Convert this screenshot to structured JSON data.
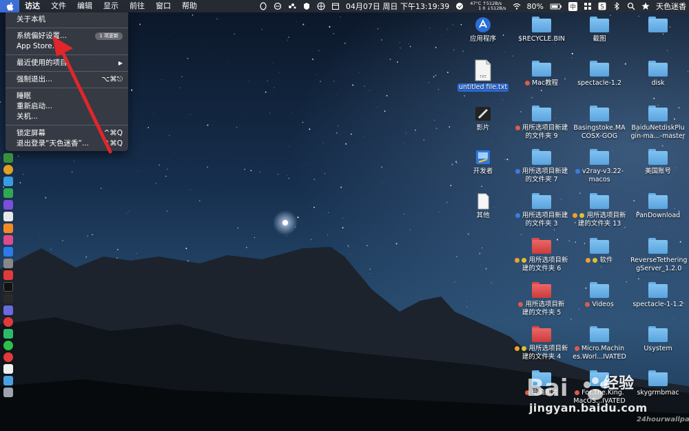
{
  "menubar": {
    "app_name": "访达",
    "menus": [
      "文件",
      "编辑",
      "显示",
      "前往",
      "窗口",
      "帮助"
    ],
    "clock": "04月07日 周日 下午13:19:39",
    "cpu_temp": "47°C",
    "cpu_value": "1",
    "net_up": "↑512B/s",
    "net_down_prefix": "0",
    "net_down": "↓512B/s",
    "battery_percent": "80%",
    "input_method": "中",
    "user_name": "天色迷香"
  },
  "apple_menu": {
    "items": [
      {
        "label": "关于本机"
      },
      {
        "label": "系统偏好设置...",
        "badge": "1 项更新"
      },
      {
        "label": "App Store..."
      },
      {
        "label": "最近使用的项目",
        "submenu": "▶"
      },
      {
        "label": "强制退出...",
        "shortcut": "⌥⌘⎋"
      },
      {
        "label": "睡眠"
      },
      {
        "label": "重新启动..."
      },
      {
        "label": "关机..."
      },
      {
        "label": "锁定屏幕",
        "shortcut": "^⌘Q"
      },
      {
        "label": "退出登录“天色迷香”...",
        "shortcut": "⇧⌘Q"
      }
    ]
  },
  "desktop": {
    "col1": [
      {
        "label": "应用程序",
        "icon": "apps-icon"
      },
      {
        "label": "untitled file.txt",
        "icon": "text-file-icon",
        "selected": true
      },
      {
        "label": "影片",
        "icon": "movies-icon"
      },
      {
        "label": "开发者",
        "icon": "developer-icon"
      },
      {
        "label": "其他",
        "icon": "document-icon"
      }
    ],
    "col2": [
      {
        "label": "$RECYCLE.BIN",
        "color": "blue",
        "tags": []
      },
      {
        "label": "Mac教程",
        "color": "blue",
        "tags": [
          "#e05a4a"
        ]
      },
      {
        "label": "用所选项目新建的文件夹 9",
        "line1": "用所选项目新建",
        "line2": "的文件夹 9",
        "color": "blue",
        "tags": [
          "#e05a4a"
        ]
      },
      {
        "label": "用所选项目新建的文件夹 7",
        "line1": "用所选项目新建",
        "line2": "的文件夹 7",
        "color": "blue",
        "tags": [
          "#3d7be0"
        ]
      },
      {
        "label": "用所选项目新建的文件夹 3",
        "line1": "用所选项目新建",
        "line2": "的文件夹 3",
        "color": "blue",
        "tags": [
          "#3d7be0"
        ]
      },
      {
        "label": "用所选项目新建的文件夹 6",
        "line1": "用所选项目新",
        "line2": "建的文件夹 6",
        "color": "red",
        "tags": [
          "#f0a030",
          "#e0c030"
        ]
      },
      {
        "label": "用所选项目新建的文件夹 5",
        "line1": "用所选项目新",
        "line2": "建的文件夹 5",
        "color": "red",
        "tags": [
          "#e05a4a"
        ]
      },
      {
        "label": "用所选项目新建的文件夹 4",
        "line1": "用所选项目新",
        "line2": "建的文件夹 4",
        "color": "red",
        "tags": [
          "#f0a030",
          "#e0c030"
        ]
      },
      {
        "label": "电脑图片",
        "color": "blue",
        "tags": [
          "#e05a4a"
        ]
      }
    ],
    "col3": [
      {
        "label": "截图",
        "color": "blue",
        "tags": []
      },
      {
        "label": "spectacle-1.2",
        "color": "blue",
        "tags": []
      },
      {
        "label": "Basingstoke.MACOSX-GOG",
        "line1": "Basingstoke.MA",
        "line2": "COSX-GOG",
        "color": "blue",
        "tags": []
      },
      {
        "label": "v2ray-v3.22-macos",
        "line1": "v2ray-v3.22-",
        "line2": "macos",
        "color": "blue",
        "tags": [
          "#3d7be0"
        ]
      },
      {
        "label": "用所选项目新建的文件夹 13",
        "line1": "用所选项目新",
        "line2": "建的文件夹 13",
        "color": "blue",
        "tags": [
          "#f0a030",
          "#e0c030"
        ]
      },
      {
        "label": "软件",
        "color": "blue",
        "tags": [
          "#f0a030",
          "#e0c030"
        ]
      },
      {
        "label": "Videos",
        "color": "blue",
        "tags": [
          "#e05a4a"
        ]
      },
      {
        "label": "Micro.Machines.World...IVATED",
        "line1": "Micro.Machin",
        "line2": "es.Worl...IVATED",
        "color": "blue",
        "tags": [
          "#e05a4a"
        ]
      },
      {
        "label": "For.The.King.MacOS...IVATED",
        "line1": "For.The.King.",
        "line2": "MacOS...IVATED",
        "color": "blue",
        "tags": [
          "#e05a4a"
        ]
      }
    ],
    "col4": [
      {
        "label": "",
        "color": "blue"
      },
      {
        "label": "disk",
        "color": "blue"
      },
      {
        "label": "BaiduNetdiskPlugin-ma...-master",
        "line1": "BaiduNetdiskPlu",
        "line2": "gin-ma...-master",
        "color": "blue"
      },
      {
        "label": "美国账号",
        "color": "blue"
      },
      {
        "label": "PanDownload",
        "color": "blue"
      },
      {
        "label": "ReverseTetheringServer_1.2.0",
        "line1": "ReverseTethering",
        "line2": "gServer_1.2.0",
        "color": "blue"
      },
      {
        "label": "spectacle-1-1.2",
        "color": "blue"
      },
      {
        "label": "Usystem",
        "color": "blue"
      },
      {
        "label": "skygrmbmac",
        "color": "blue"
      }
    ]
  },
  "watermarks": {
    "baidu_url": "jingyan.baidu.com",
    "baidu_title": "经验",
    "wallpaper_site": "24hourwallpa"
  }
}
